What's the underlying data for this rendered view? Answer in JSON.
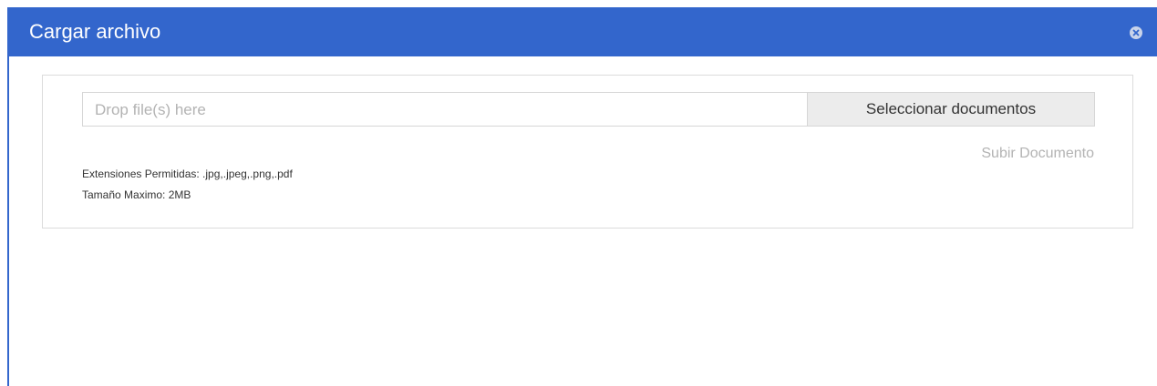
{
  "dialog": {
    "title": "Cargar archivo",
    "close_icon": "close-circle-icon",
    "accent_color": "#3366cc"
  },
  "upload": {
    "drop_placeholder": "Drop file(s) here",
    "select_button_label": "Seleccionar documentos",
    "upload_link_label": "Subir Documento"
  },
  "info": {
    "allowed_extensions": "Extensiones Permitidas: .jpg,.jpeg,.png,.pdf",
    "max_size": "Tamaño Maximo: 2MB"
  }
}
